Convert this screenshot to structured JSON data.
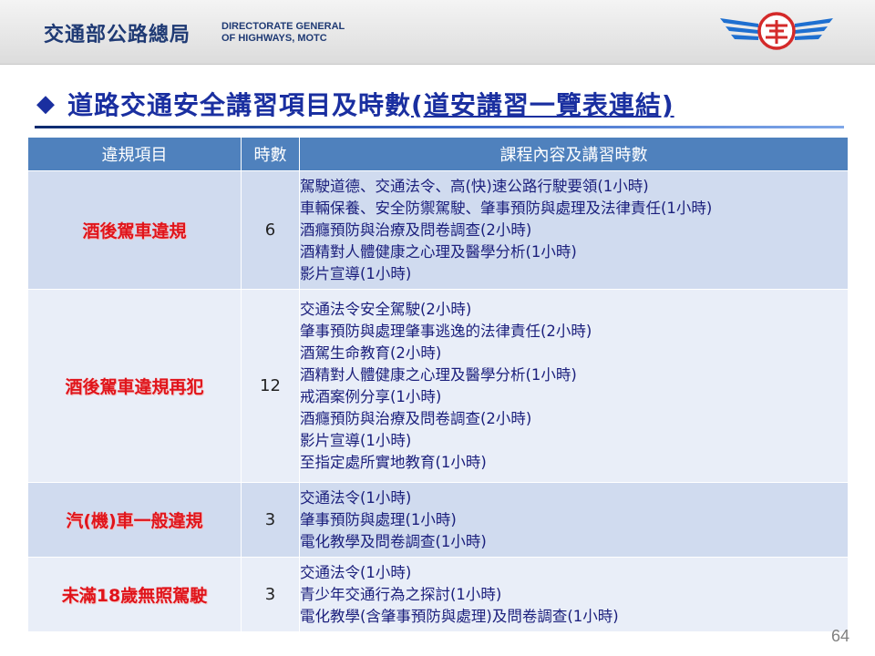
{
  "header": {
    "org_cn": "交通部公路總局",
    "org_en_line1": "DIRECTORATE GENERAL",
    "org_en_line2": "OF HIGHWAYS, MOTC"
  },
  "title": {
    "bullet": "◆",
    "text": "道路交通安全講習項目及時數",
    "link": "(道安講習一覽表連結)"
  },
  "table": {
    "headers": [
      "違規項目",
      "時數",
      "課程內容及講習時數"
    ],
    "rows": [
      {
        "item": "酒後駕車違規",
        "hours": "6",
        "courses": [
          "駕駛道德、交通法令、高(快)速公路行駛要領(1小時)",
          "車輛保養、安全防禦駕駛、肇事預防與處理及法律責任(1小時)",
          "酒癮預防與治療及問卷調查(2小時)",
          "酒精對人體健康之心理及醫學分析(1小時)",
          "影片宣導(1小時)"
        ]
      },
      {
        "item": "酒後駕車違規再犯",
        "hours": "12",
        "courses": [
          "交通法令安全駕駛(2小時)",
          "肇事預防與處理肇事逃逸的法律責任(2小時)",
          "酒駕生命教育(2小時)",
          "酒精對人體健康之心理及醫學分析(1小時)",
          "戒酒案例分享(1小時)",
          "酒癮預防與治療及問卷調查(2小時)",
          "影片宣導(1小時)",
          "至指定處所實地教育(1小時)"
        ]
      },
      {
        "item": "汽(機)車一般違規",
        "hours": "3",
        "courses": [
          "交通法令(1小時)",
          "肇事預防與處理(1小時)",
          "電化教學及問卷調查(1小時)"
        ]
      },
      {
        "item": "未滿18歲無照駕駛",
        "hours": "3",
        "courses": [
          "交通法令(1小時)",
          "青少年交通行為之探討(1小時)",
          "電化教學(含肇事預防與處理)及問卷調查(1小時)"
        ]
      }
    ]
  },
  "page_number": "64",
  "colors": {
    "header_blue": "#1f3a74",
    "title_blue": "#1a2fa0",
    "table_header": "#4f81bd",
    "row_odd": "#d0dbef",
    "row_even": "#e9eef8",
    "item_red": "#e0141b",
    "course_text": "#1b1f7c",
    "logo_blue": "#1e6fd0",
    "logo_red": "#d42a2a"
  }
}
